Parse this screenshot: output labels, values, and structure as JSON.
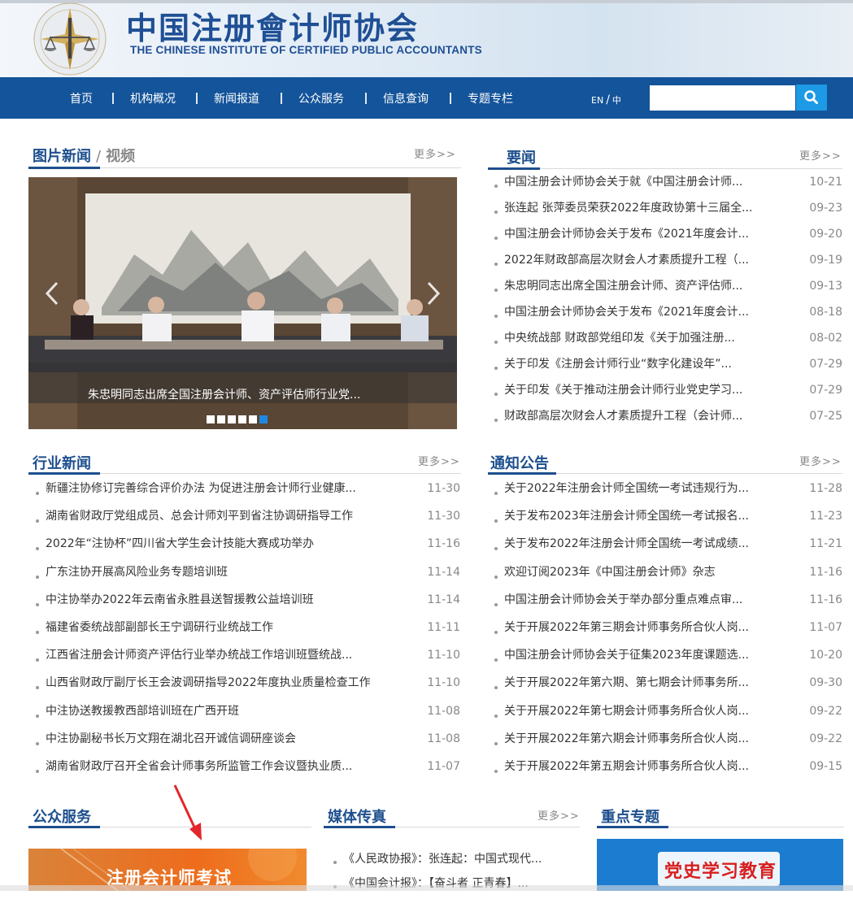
{
  "header": {
    "title_cn": "中国注册會计师协会",
    "title_en": "THE CHINESE INSTITUTE OF CERTIFIED PUBLIC ACCOUNTANTS"
  },
  "nav": {
    "items": [
      "首页",
      "机构概况",
      "新闻报道",
      "公众服务",
      "信息查询",
      "专题专栏"
    ],
    "lang_en": "EN",
    "lang_sep": "/",
    "lang_cn": "中",
    "search_placeholder": ""
  },
  "photo_news": {
    "title": "图片新闻",
    "sep": "/",
    "video_label": "视频",
    "more": "更多>>",
    "caption": "朱忠明同志出席全国注册会计师、资产评估师行业党...",
    "slide_count": 6,
    "active_slide": 6
  },
  "yaowen": {
    "title": "要闻",
    "more": "更多>>",
    "items": [
      {
        "title": "中国注册会计师协会关于就《中国注册会计师...",
        "date": "10-21"
      },
      {
        "title": "张连起 张萍委员荣获2022年度政协第十三届全...",
        "date": "09-23"
      },
      {
        "title": "中国注册会计师协会关于发布《2021年度会计...",
        "date": "09-20"
      },
      {
        "title": "2022年财政部高层次财会人才素质提升工程（...",
        "date": "09-19"
      },
      {
        "title": "朱忠明同志出席全国注册会计师、资产评估师...",
        "date": "09-13"
      },
      {
        "title": "中国注册会计师协会关于发布《2021年度会计...",
        "date": "08-18"
      },
      {
        "title": "中央统战部 财政部党组印发《关于加强注册...",
        "date": "08-02"
      },
      {
        "title": "关于印发《注册会计师行业“数字化建设年”...",
        "date": "07-29"
      },
      {
        "title": "关于印发《关于推动注册会计师行业党史学习...",
        "date": "07-29"
      },
      {
        "title": "财政部高层次财会人才素质提升工程（会计师...",
        "date": "07-25"
      }
    ]
  },
  "industry_news": {
    "title": "行业新闻",
    "more": "更多>>",
    "items": [
      {
        "title": "新疆注协修订完善综合评价办法 为促进注册会计师行业健康...",
        "date": "11-30"
      },
      {
        "title": "湖南省财政厅党组成员、总会计师刘平到省注协调研指导工作",
        "date": "11-30"
      },
      {
        "title": "2022年“注协杯”四川省大学生会计技能大赛成功举办",
        "date": "11-16"
      },
      {
        "title": "广东注协开展高风险业务专题培训班",
        "date": "11-14"
      },
      {
        "title": "中注协举办2022年云南省永胜县送智援教公益培训班",
        "date": "11-14"
      },
      {
        "title": "福建省委统战部副部长王宁调研行业统战工作",
        "date": "11-11"
      },
      {
        "title": "江西省注册会计师资产评估行业举办统战工作培训班暨统战...",
        "date": "11-10"
      },
      {
        "title": "山西省财政厅副厅长王会波调研指导2022年度执业质量检查工作",
        "date": "11-10"
      },
      {
        "title": "中注协送教援教西部培训班在广西开班",
        "date": "11-08"
      },
      {
        "title": "中注协副秘书长万文翔在湖北召开诚信调研座谈会",
        "date": "11-08"
      },
      {
        "title": "湖南省财政厅召开全省会计师事务所监管工作会议暨执业质...",
        "date": "11-07"
      }
    ]
  },
  "notices": {
    "title": "通知公告",
    "more": "更多>>",
    "items": [
      {
        "title": "关于2022年注册会计师全国统一考试违规行为...",
        "date": "11-28"
      },
      {
        "title": "关于发布2023年注册会计师全国统一考试报名...",
        "date": "11-23"
      },
      {
        "title": "关于发布2022年注册会计师全国统一考试成绩...",
        "date": "11-21"
      },
      {
        "title": "欢迎订阅2023年《中国注册会计师》杂志",
        "date": "11-16"
      },
      {
        "title": "中国注册会计师协会关于举办部分重点难点审...",
        "date": "11-16"
      },
      {
        "title": "关于开展2022年第三期会计师事务所合伙人岗...",
        "date": "11-07"
      },
      {
        "title": "中国注册会计师协会关于征集2023年度课题选...",
        "date": "10-20"
      },
      {
        "title": "关于开展2022年第六期、第七期会计师事务所...",
        "date": "09-30"
      },
      {
        "title": "关于开展2022年第七期会计师事务所合伙人岗...",
        "date": "09-22"
      },
      {
        "title": "关于开展2022年第六期会计师事务所合伙人岗...",
        "date": "09-22"
      },
      {
        "title": "关于开展2022年第五期会计师事务所合伙人岗...",
        "date": "09-15"
      }
    ]
  },
  "public_service": {
    "title": "公众服务",
    "banner": "注册会计师考试"
  },
  "media": {
    "title": "媒体传真",
    "more": "更多>>",
    "items": [
      {
        "title": "《人民政协报》：张连起：中国式现代..."
      },
      {
        "title": "《中国会计报》：【奋斗者 正青春】..."
      }
    ]
  },
  "topics": {
    "title": "重点专题",
    "banner": "党史学习教育"
  },
  "colors": {
    "nav_bg": "#14549a",
    "title_blue": "#1d4f8d",
    "search_btn": "#1d9ae5",
    "active_dot": "#1e88e5"
  }
}
